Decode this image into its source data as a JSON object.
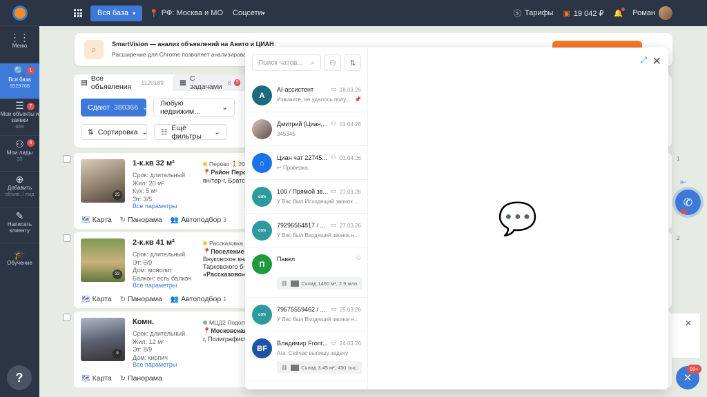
{
  "sidebar": {
    "items": [
      {
        "label": "Меню",
        "sub": "",
        "icon": "grid-icon",
        "badge": ""
      },
      {
        "label": "Вся база",
        "sub": "6529768",
        "icon": "search-doc-icon",
        "badge": "1"
      },
      {
        "label": "Мои объекты и заявки",
        "sub": "669",
        "icon": "list-icon",
        "badge": "7"
      },
      {
        "label": "Мои лиды",
        "sub": "33",
        "icon": "add-user-icon",
        "badge": "4"
      },
      {
        "label": "Добавить",
        "sub": "объяв. / лид",
        "icon": "plus-circle-icon",
        "badge": ""
      },
      {
        "label": "Написать клиенту",
        "sub": "",
        "icon": "edit-icon",
        "badge": ""
      },
      {
        "label": "Обучение",
        "sub": "",
        "icon": "graduation-icon",
        "badge": ""
      }
    ],
    "help": "?"
  },
  "topbar": {
    "db_button": "Вся база",
    "region": "РФ: Москва и МО",
    "social": "Соцсети",
    "tariffs": "Тарифы",
    "balance": "19 042 ₽",
    "user": "Роман"
  },
  "banner": {
    "title": "SmartVision — анализ объявлений на Авито и ЦИАН",
    "text": "Расширение для Chrome позволяет анализировать к"
  },
  "filters": {
    "tab_all": "Все объявления",
    "tab_all_count": "1120189",
    "tab_tasks": "С задачами",
    "tab_tasks_count": "8",
    "tab_tasks_badge": "5",
    "deal": "Сдают",
    "deal_count": "380366",
    "property": "Любую недвижим...",
    "sort": "Сортировка",
    "more": "Ещё фильтры"
  },
  "listings": [
    {
      "title": "1-к.кв 32 м²",
      "params": [
        "Срок: длительный",
        "Жил: 20 м²",
        "Кух: 5 м²",
        "Эт: 3/5"
      ],
      "link": "Все параметры",
      "photos": "25",
      "metro": "Перово",
      "metro_extra": "20",
      "metro_color": "#f5c33b",
      "addr1": "Район Перов",
      "addr2": "вн/тер-г, Братс",
      "actions": [
        "Карта",
        "Панорама",
        "Автоподбор"
      ],
      "autopick": "3"
    },
    {
      "title": "2-к.кв 41 м²",
      "params": [
        "Срок: длительный",
        "Эт: 6/9",
        "Дом: монолит",
        "Балкон: есть балкон"
      ],
      "link": "Все параметры",
      "photos": "32",
      "metro": "Рассказовка",
      "metro_extra": "",
      "metro_color": "#f5c33b",
      "addr1": "Поселение В",
      "addr2": "Внуковское вн/",
      "addr3": "Тарковского б-",
      "addr4": "«Рассказово» (",
      "actions": [
        "Карта",
        "Панорама",
        "Автоподбор"
      ],
      "autopick": "1"
    },
    {
      "title": "Комн.",
      "params": [
        "Срок: длительный",
        "Жил: 12 м²",
        "Эт: 8/9",
        "Дом: кирпич"
      ],
      "link": "Все параметры",
      "photos": "9",
      "metro": "МЦД2 Подоль",
      "metro_extra": "",
      "metro_color": "#9aa0a6",
      "addr1": "Московская",
      "addr2": "г, Полиграфист",
      "actions": [
        "Карта",
        "Панорама"
      ],
      "autopick": ""
    }
  ],
  "chat": {
    "search_placeholder": "Поиск чатов...",
    "items": [
      {
        "initials": "A",
        "color": "#1e6b7d",
        "name": "AI-ассистент",
        "date": "18.03.26",
        "msg": "Извините, не удалось полу...",
        "kind": "chat-icon",
        "pinned": true
      },
      {
        "initials": "",
        "color": "#8a6a5a",
        "name": "Дмитрий (Циан,...",
        "date": "01.04.26",
        "msg": "345345",
        "kind": "person-icon"
      },
      {
        "initials": "",
        "color": "#1a73e8",
        "name": "Циан чат 22745...",
        "date": "01.04.26",
        "msg": "Проверка.",
        "kind": "person-icon"
      },
      {
        "initials": "crm",
        "color": "#2e9a9e",
        "name": "100 / Прямой зв...",
        "date": "27.03.26",
        "msg": "У Вас был Исходящий звонок ...",
        "kind": "chat-icon"
      },
      {
        "initials": "crm",
        "color": "#2e9a9e",
        "name": "79296564817 / ...",
        "date": "27.03.26",
        "msg": "У Вас был Входящий звонок н...",
        "kind": "chat-icon"
      },
      {
        "initials": "П",
        "color": "#1f9a3e",
        "name": "Павел",
        "date": "",
        "msg": "",
        "tag": "Склад 1450 м², 2.9 млн.",
        "kind": "person-icon"
      },
      {
        "initials": "crm",
        "color": "#2e9a9e",
        "name": "79675559462 / ...",
        "date": "25.03.26",
        "msg": "У Вас был Входящий звонок н...",
        "kind": "chat-icon"
      },
      {
        "initials": "BF",
        "color": "#1e54a6",
        "name": "Владимир Front...",
        "date": "24.03.26",
        "msg": "Ага. Сейчас выпишу задачу",
        "tag": "Склад 3.45 м², 430 тыс.",
        "kind": "person-icon"
      }
    ]
  },
  "right": {
    "nums": [
      "1",
      "2"
    ],
    "fab_badge": "99+"
  },
  "colors": {
    "sidebar": "#2b3545",
    "accent": "#3d79d8",
    "orange": "#f07a2a",
    "badge": "#e15050"
  }
}
